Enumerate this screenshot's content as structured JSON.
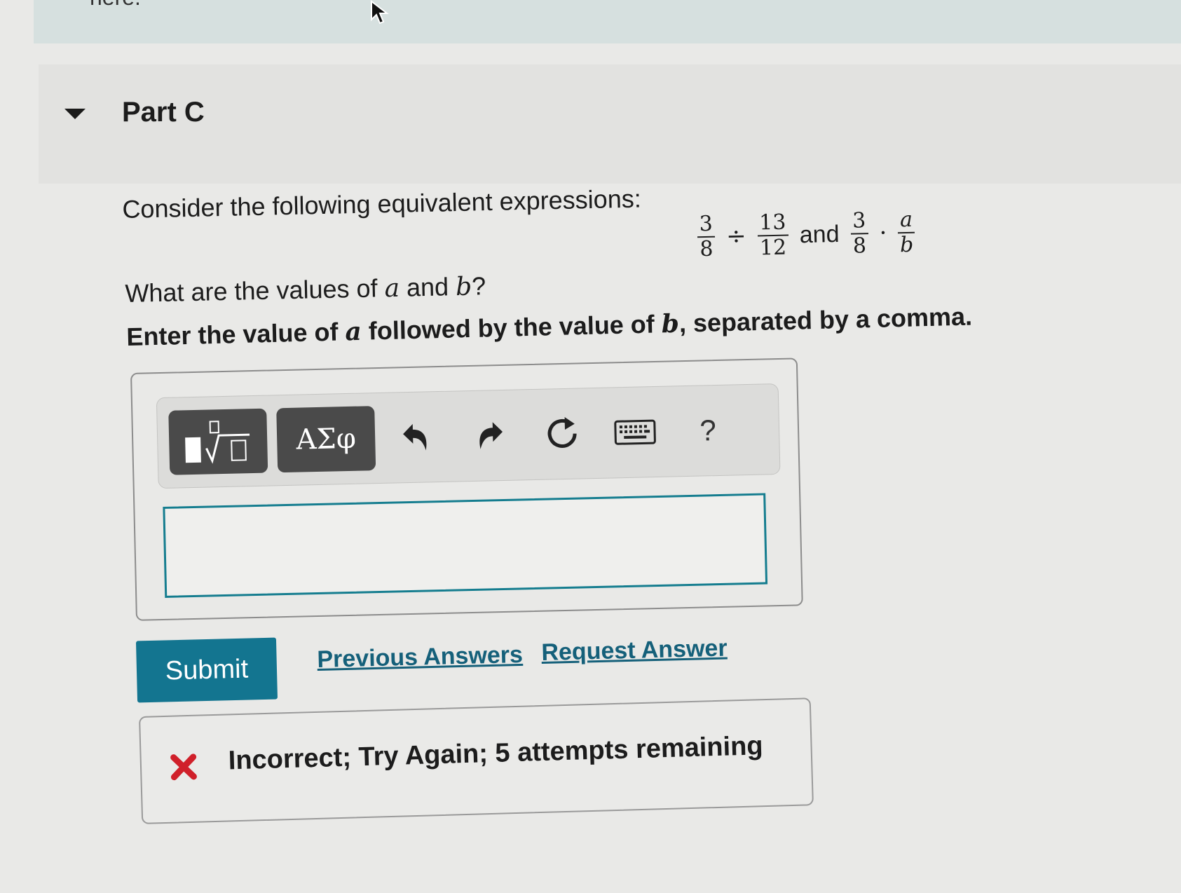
{
  "top_banner": {
    "fragment_text": "here."
  },
  "part": {
    "title": "Part C",
    "expanded": true
  },
  "problem": {
    "prompt": "Consider the following equivalent expressions:",
    "expression": {
      "left": {
        "frac1": {
          "num": "3",
          "den": "8"
        },
        "operator": "÷",
        "frac2": {
          "num": "13",
          "den": "12"
        }
      },
      "conjunction": "and",
      "right": {
        "frac1": {
          "num": "3",
          "den": "8"
        },
        "operator": "·",
        "frac2": {
          "num": "a",
          "den": "b"
        }
      }
    },
    "question": {
      "pre": "What are the values of ",
      "var_a": "a",
      "mid": " and ",
      "var_b": "b",
      "post": "?"
    },
    "instruction": {
      "pre": "Enter the value of ",
      "var_a": "a",
      "mid": " followed by the value of ",
      "var_b": "b",
      "post": ", separated by a comma."
    }
  },
  "toolbar": {
    "templates_icon": "fraction-root-template-icon",
    "greek_label": "ΑΣφ",
    "undo_icon": "undo-icon",
    "redo_icon": "redo-icon",
    "reset_icon": "reset-icon",
    "keyboard_icon": "keyboard-icon",
    "help_label": "?"
  },
  "answer": {
    "value": "",
    "placeholder": ""
  },
  "actions": {
    "submit_label": "Submit",
    "previous_answers_label": "Previous Answers",
    "request_answer_label": "Request Answer"
  },
  "feedback": {
    "status": "incorrect",
    "message": "Incorrect; Try Again; 5 attempts remaining",
    "icon_color": "#d0202a"
  },
  "colors": {
    "accent": "#137590",
    "input_border": "#157d8f",
    "link": "#15607a"
  }
}
